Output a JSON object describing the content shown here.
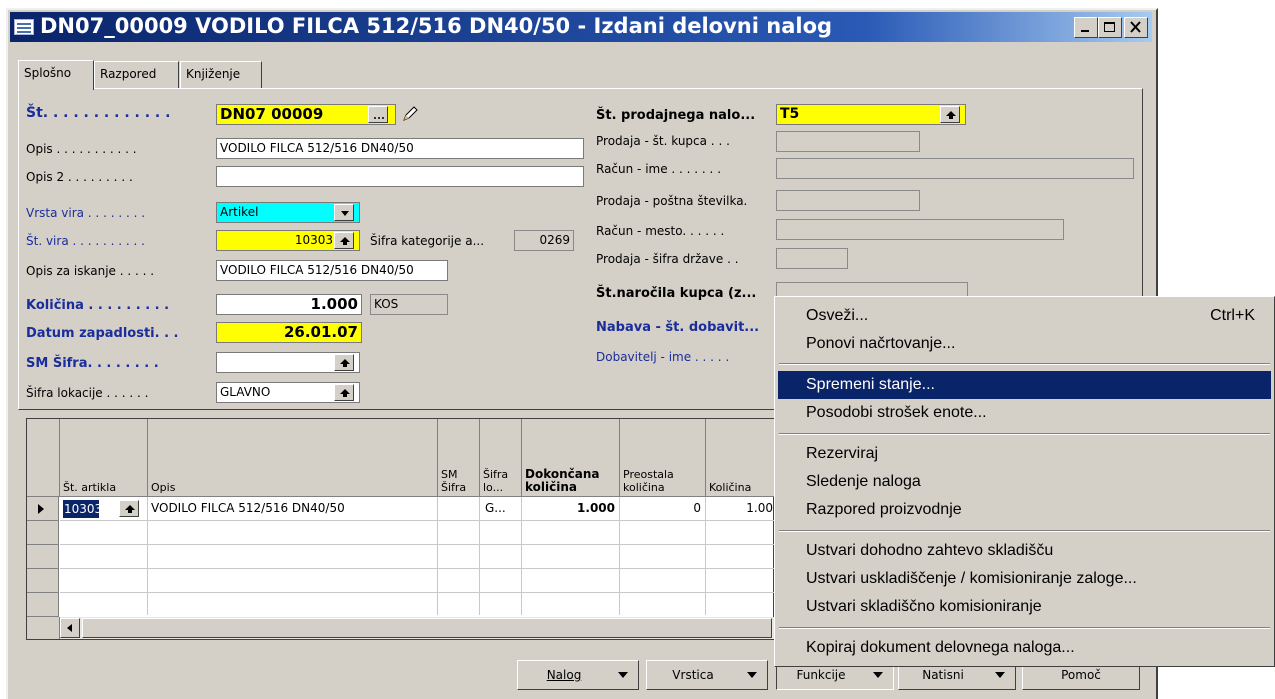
{
  "window": {
    "title": "DN07_00009 VODILO FILCA 512/516 DN40/50 - Izdani delovni nalog"
  },
  "tabs": [
    "Splošno",
    "Razpored",
    "Knjiženje"
  ],
  "left": {
    "st_label": "Št. . . . . . . . . . . . .",
    "st_value": "DN07 00009",
    "opis_label": "Opis . . . . . . . . . . .",
    "opis_value": "VODILO FILCA 512/516 DN40/50",
    "opis2_label": "Opis 2 . . . . . . . . .",
    "opis2_value": "",
    "vrsta_vira_label": "Vrsta vira . . . . . . . .",
    "vrsta_vira_value": "Artikel",
    "st_vira_label": "Št. vira . . . . . . . . . .",
    "st_vira_value": "10303",
    "sifra_kat_label": "Šifra kategorije a...",
    "sifra_kat_value": "0269",
    "opis_iskanje_label": "Opis za iskanje . . . . .",
    "opis_iskanje_value": "VODILO FILCA 512/516 DN40/50",
    "kolicina_label": "Količina . . . . . . . . .",
    "kolicina_value": "1.000",
    "kolicina_unit": "KOS",
    "datum_label": "Datum zapadlosti. . .",
    "datum_value": "26.01.07",
    "sm_sifra_label": "SM Šifra. . . . . . . .",
    "sm_sifra_value": "",
    "sifra_lok_label": "Šifra lokacije . . . . . .",
    "sifra_lok_value": "GLAVNO"
  },
  "right": {
    "st_prod_label": "Št. prodajnega nalo...",
    "st_prod_value": "T5",
    "prod_kupca_label": "Prodaja - št. kupca . . .",
    "racun_ime_label": "Račun - ime . . . . . . .",
    "prod_postna_label": "Prodaja - poštna številka.",
    "racun_mesto_label": "Račun - mesto. . . . . .",
    "prod_drzave_label": "Prodaja - šifra države . .",
    "st_narocila_label": "Št.naročila kupca (z...",
    "nabava_label": "Nabava - št. dobavit...",
    "dobavitelj_label": "Dobavitelj - ime . . . . ."
  },
  "grid": {
    "headers": {
      "st_artikla": "Št. artikla",
      "opis": "Opis",
      "sm_sifra": "SM Šifra",
      "sifra_lo": "Šifra lo...",
      "dokoncana": "Dokončana količina",
      "preostala": "Preostala količina",
      "kolicina": "Količina"
    },
    "row1": {
      "st_artikla": "10303",
      "opis": "VODILO FILCA 512/516 DN40/50",
      "sifra_lo": "G...",
      "dokoncana": "1.000",
      "preostala": "0",
      "kolicina": "1.00"
    }
  },
  "buttons": {
    "nalog": "Nalog",
    "vrstica": "Vrstica",
    "funkcije": "Funkcije",
    "natisni": "Natisni",
    "pomoc": "Pomoč"
  },
  "menu": {
    "items": [
      {
        "label": "Osveži...",
        "shortcut": "Ctrl+K"
      },
      {
        "label": "Ponovi načrtovanje..."
      },
      {
        "label": "Spremeni stanje..."
      },
      {
        "label": "Posodobi strošek enote..."
      },
      {
        "label": "Rezerviraj"
      },
      {
        "label": "Sledenje naloga"
      },
      {
        "label": "Razpored proizvodnje"
      },
      {
        "label": "Ustvari dohodno zahtevo skladišču"
      },
      {
        "label": "Ustvari uskladiščenje / komisioniranje zaloge..."
      },
      {
        "label": "Ustvari skladiščno komisioniranje"
      },
      {
        "label": "Kopiraj dokument delovnega naloga..."
      }
    ],
    "highlighted_index": 2
  },
  "colors": {
    "title_bar": "#0a246a",
    "highlight": "#0a246a",
    "required_field": "#ffff00",
    "option_field": "#00ffff",
    "label_blue": "#1a2d9a"
  }
}
